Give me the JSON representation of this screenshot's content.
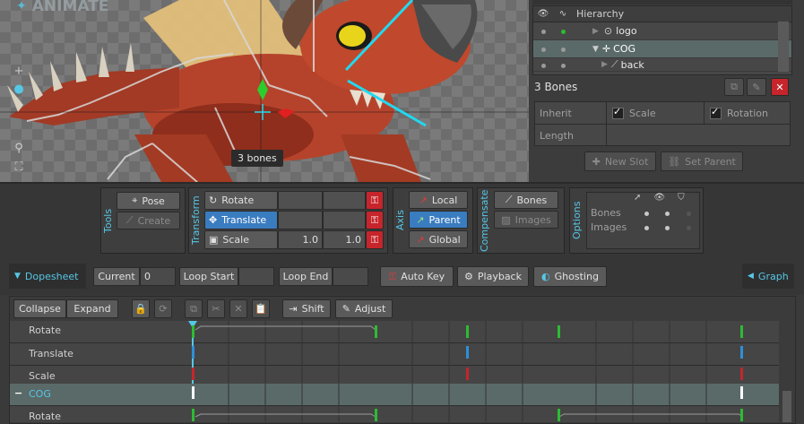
{
  "viewport": {
    "watermark": "ANIMATE",
    "bones_label": "3 bones",
    "tools": [
      {
        "icon": "plus-icon"
      },
      {
        "icon": "dot-icon"
      },
      {
        "icon": "zoom-icon"
      },
      {
        "icon": "fit-icon"
      }
    ]
  },
  "hierarchy": {
    "header": "Hierarchy",
    "items": [
      {
        "label": "logo",
        "icon": "logo-icon"
      },
      {
        "label": "COG",
        "icon": "bone-cross-icon",
        "selected": true
      },
      {
        "label": "back",
        "icon": "bone-icon"
      }
    ]
  },
  "selection": {
    "title": "3 Bones",
    "inherit_label": "Inherit",
    "scale_label": "Scale",
    "rotation_label": "Rotation",
    "length_label": "Length",
    "new_slot": "New Slot",
    "set_parent": "Set Parent"
  },
  "tools_group": {
    "title": "Tools",
    "pose": "Pose",
    "create": "Create"
  },
  "transform_group": {
    "title": "Transform",
    "rows": [
      {
        "label": "Rotate",
        "value1": "",
        "value2": ""
      },
      {
        "label": "Translate",
        "value1": "",
        "value2": "",
        "active": true
      },
      {
        "label": "Scale",
        "value1": "1.0",
        "value2": "1.0"
      }
    ]
  },
  "axis_group": {
    "title": "Axis",
    "local": "Local",
    "parent": "Parent",
    "global": "Global"
  },
  "compensate_group": {
    "title": "Compensate",
    "bones": "Bones",
    "images": "Images"
  },
  "options_group": {
    "title": "Options",
    "bones": "Bones",
    "images": "Images"
  },
  "dopesheet_bar": {
    "dopesheet": "Dopesheet",
    "current_label": "Current",
    "current_value": "0",
    "loop_start": "Loop Start",
    "loop_end": "Loop End",
    "auto_key": "Auto Key",
    "playback": "Playback",
    "ghosting": "Ghosting",
    "graph": "Graph"
  },
  "dopesheet": {
    "collapse": "Collapse",
    "expand": "Expand",
    "shift": "Shift",
    "adjust": "Adjust",
    "tracks": [
      {
        "label": "Rotate"
      },
      {
        "label": "Translate"
      },
      {
        "label": "Scale"
      },
      {
        "label": "COG",
        "group": true
      },
      {
        "label": "Rotate"
      }
    ]
  },
  "colors": {
    "accent": "#56c7e6",
    "rotate_key": "#2dbb33",
    "translate_key": "#2f8fd8",
    "scale_key": "#c6252b",
    "selected_row": "#5a6a68"
  }
}
